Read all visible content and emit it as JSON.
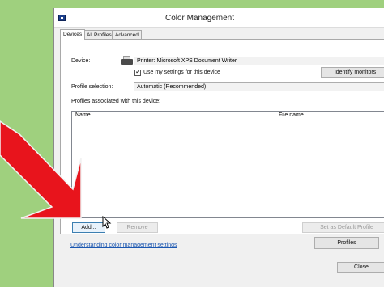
{
  "window": {
    "title": "Color Management"
  },
  "tabs": [
    {
      "label": "Devices",
      "active": true
    },
    {
      "label": "All Profiles",
      "active": false
    },
    {
      "label": "Advanced",
      "active": false
    }
  ],
  "device": {
    "label": "Device:",
    "selected": "Printer: Microsoft XPS Document Writer",
    "use_settings_label": "Use my settings for this device",
    "use_settings_checked": true,
    "identify_button": "Identify monitors"
  },
  "profile_selection": {
    "label": "Profile selection:",
    "selected": "Automatic (Recommended)"
  },
  "profiles_list": {
    "label": "Profiles associated with this device:",
    "columns": [
      "Name",
      "File name"
    ],
    "rows": []
  },
  "buttons": {
    "add": "Add...",
    "remove": "Remove",
    "set_default": "Set as Default Profile",
    "profiles": "Profiles",
    "close": "Close"
  },
  "link": {
    "text": "Understanding color management settings"
  },
  "colors": {
    "background": "#9fd07e",
    "arrow": "#e8141c",
    "link": "#1a56b0"
  }
}
